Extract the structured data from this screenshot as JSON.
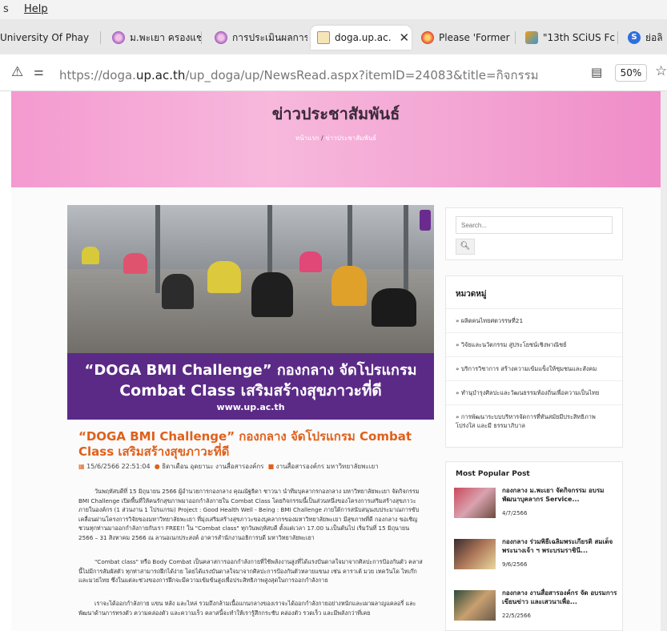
{
  "menubar": {
    "fragment": "s",
    "help": "Help"
  },
  "tabs": [
    {
      "label": "University Of Phay",
      "active": false
    },
    {
      "label": "ม.พะเยา ครองแช",
      "active": false
    },
    {
      "label": "การประเมินผลการ",
      "active": false
    },
    {
      "label": "doga.up.ac.",
      "active": true
    },
    {
      "label": "Please 'Former",
      "active": false
    },
    {
      "label": "\"13th SCiUS Fc",
      "active": false
    },
    {
      "label": "ย่อลิ",
      "active": false
    }
  ],
  "address": {
    "url_prefix": "https://doga.",
    "url_domain": "up.ac.th",
    "url_path": "/up_doga/up/NewsRead.aspx?itemID=24083&title=กิจกรรม",
    "zoom": "50%"
  },
  "hero": {
    "title": "ข่าวประชาสัมพันธ์",
    "crumb_home": "หน้าแรก",
    "crumb_current": "ข่าวประชาสัมพันธ์"
  },
  "feature": {
    "line1": "“DOGA BMI Challenge” กองกลาง จัดโปรแกรม",
    "line2": "Combat Class เสริมสร้างสุขภาวะที่ดี",
    "line3": "www.up.ac.th"
  },
  "article": {
    "title": "“DOGA BMI Challenge” กองกลาง จัดโปรแกรม Combat Class เสริมสร้างสุขภาวะที่ดี",
    "date": "15/6/2566 22:51:04",
    "author": "ธิดาเดือน อุดยานะ งานสื่อสารองค์กร",
    "section": "งานสื่อสารองค์กร มหาวิทยาลัยพะเยา",
    "p1": "วันพฤหัสบดีที่ 15 มิถุนายน 2566 ผู้อำนวยการกองกลาง คุณณัฐธิดา ชาวนา นำทีมบุคลากรกองกลาง มหาวิทยาลัยพะเยา จัดกิจกรรม BMI Challenge เปิดพื้นที่ให้คนรักสุขภาพมาออกกำลังกายใน Combat Class โดยกิจกรรมนี้เป็นส่วนหนึ่งของโครงการเสริมสร้างสุขภาวะภายในองค์กร (1 ส่วนงาน 1 โปรแกรม) Project : Good Health Well - Being : BMI Challenge ภายใต้การสนับสนุนงบประมาณการขับเคลื่อนผ่านโครงการวิจัยของมหาวิทยาลัยพะเยา ที่มุ่งเสริมสร้างสุขภาวะของบุคลากรของมหาวิทยาลัยพะเยา มีสุขภาพที่ดี กองกลาง ขอเชิญชวนทุกท่านมาออกกำลังกายกับเรา FREE!! ใน \"Combat class\" ทุกวันพฤหัสบดี ตั้งแต่เวลา 17.00 น.เป็นต้นไป เริ่มวันที่ 15 มิถุนายน 2566 – 31 สิงหาคม 2566 ณ ลานอเนกประสงค์ อาคารสำนักงานอธิการบดี มหาวิทยาลัยพะเยา",
    "p2": "\"Combat class\" หรือ Body Combat เป็นคลาสการออกกำลังกายที่ใช้พลังงานสูงที่ได้แรงบันดาลใจมาจากศิลปะการป้องกันตัว คลาสนี้ไม่มีการสัมผัสตัว ทุกท่าสามารถฝึกได้ง่าย โดยได้แรงบันดาลใจมาจากศิลปะการป้องกันตัวหลายแขนง เช่น คาราเต้ มวย เทควันโด ไทเก๊ก และมวยไทย ซึ่งในแต่ละช่วงของการฝึกจะมีความเข้มข้นสูงเพื่อประสิทธิภาพสูงสุดในการออกกำลังกาย",
    "p3": "เราจะได้ออกกำลังกาย แขน หลัง และไหล่ รวมถึงกล้ามเนื้อแกนกลางของเราจะได้ออกกำลังกายอย่างหนักและเผาผลาญแคลอรี่ และพัฒนาด้านการทรงตัว ความคล่องตัว และความเร็ว คลาสนี้จะทำให้เรารู้สึกกระชับ คล่องตัว รวดเร็ว และมีพลังกว่าที่เคย"
  },
  "sidebar": {
    "search_placeholder": "Search...",
    "categories_heading": "หมวดหมู่",
    "categories": [
      "» ผลิตคนไทยศตวรรษที่21",
      "» วิจัยและนวัตกรรม สู่ประโยชน์เชิงพาณิชย์",
      "» บริการวิชาการ สร้างความเข้มแข็งให้ชุมชนและสังคม",
      "» ทำนุบำรุงศิลปะและวัฒนธรรมท้องถิ่นเพื่อความเป็นไทย",
      "» การพัฒนาระบบบริหารจัดการที่ทันสมัยมีประสิทธิภาพ โปร่งใส และมี ธรรมาภิบาล"
    ],
    "popular_heading": "Most Popular Post",
    "popular": [
      {
        "title": "กองกลาง ม.พะเยา จัดกิจกรรม อบรมพัฒนาบุคลากร Service...",
        "date": "4/7/2566"
      },
      {
        "title": "กองกลาง ร่วมพิธีเฉลิมพระเกียรติ สมเด็จพระนางเจ้า ฯ พระบรมราชินี...",
        "date": "9/6/2566"
      },
      {
        "title": "กองกลาง งานสื่อสารองค์กร จัด อบรมการเขียนข่าว และเสวนาเพื่อ...",
        "date": "22/5/2566"
      }
    ]
  },
  "colors": {
    "accent_orange": "#e0601c",
    "banner_purple": "#5b2a86",
    "hero_pink": "#f49ad0"
  }
}
